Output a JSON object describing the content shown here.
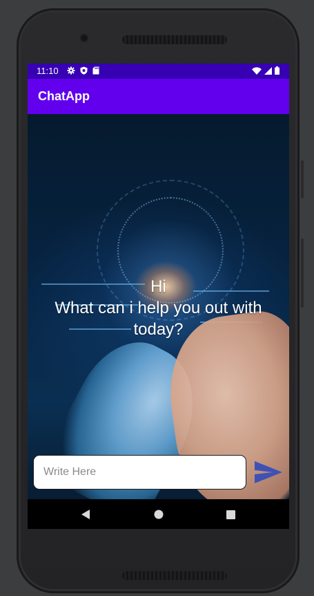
{
  "statusbar": {
    "time": "11:10",
    "icons_left": [
      "gear-icon",
      "shield-icon",
      "sd-card-icon"
    ],
    "icons_right": [
      "wifi-icon",
      "signal-icon",
      "battery-icon"
    ]
  },
  "appbar": {
    "title": "ChatApp"
  },
  "main": {
    "greeting_line1": "Hi",
    "greeting_line2": "What can i help you out with",
    "greeting_line3": "today?"
  },
  "composer": {
    "placeholder": "Write Here",
    "value": "",
    "send_icon": "send-icon"
  },
  "navbar": {
    "buttons": [
      "back-icon",
      "home-icon",
      "recents-icon"
    ]
  },
  "colors": {
    "status_bar": "#3700b3",
    "app_bar": "#6200ee",
    "send_accent": "#3f51b5"
  }
}
